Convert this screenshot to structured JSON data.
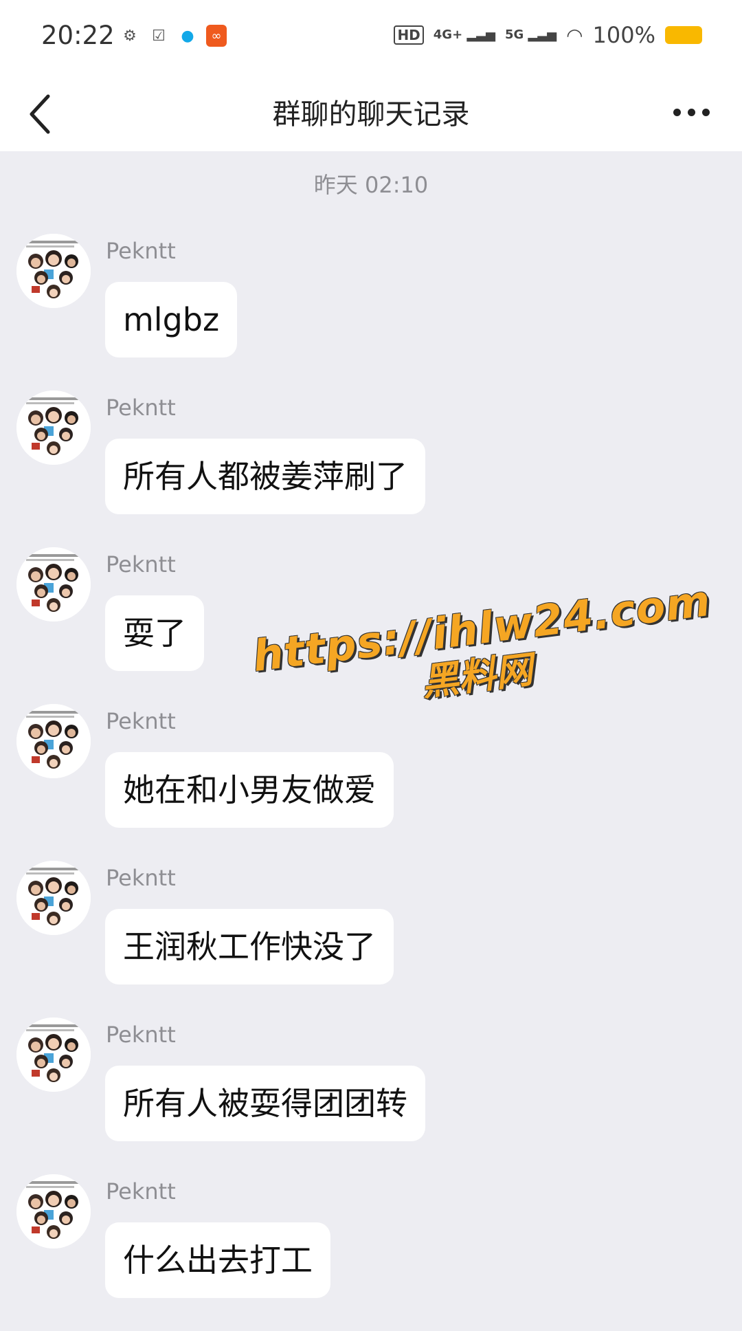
{
  "status_bar": {
    "time": "20:22",
    "hd": "HD",
    "net1": "4G+",
    "net2": "5G",
    "battery": "100%"
  },
  "header": {
    "title": "群聊的聊天记录"
  },
  "timestamp": "昨天 02:10",
  "messages": [
    {
      "sender": "Pekntt",
      "text": "mlgbz"
    },
    {
      "sender": "Pekntt",
      "text": "所有人都被姜萍刷了"
    },
    {
      "sender": "Pekntt",
      "text": "耍了"
    },
    {
      "sender": "Pekntt",
      "text": "她在和小男友做爱"
    },
    {
      "sender": "Pekntt",
      "text": "王润秋工作快没了"
    },
    {
      "sender": "Pekntt",
      "text": "所有人被耍得团团转"
    },
    {
      "sender": "Pekntt",
      "text": "什么出去打工"
    }
  ],
  "watermark": {
    "line1": "https://ihlw24.com",
    "line2": "黑料网"
  },
  "colors": {
    "background": "#ededf2",
    "bubble": "#ffffff",
    "battery": "#f9b800",
    "watermark": "#f5a623"
  }
}
